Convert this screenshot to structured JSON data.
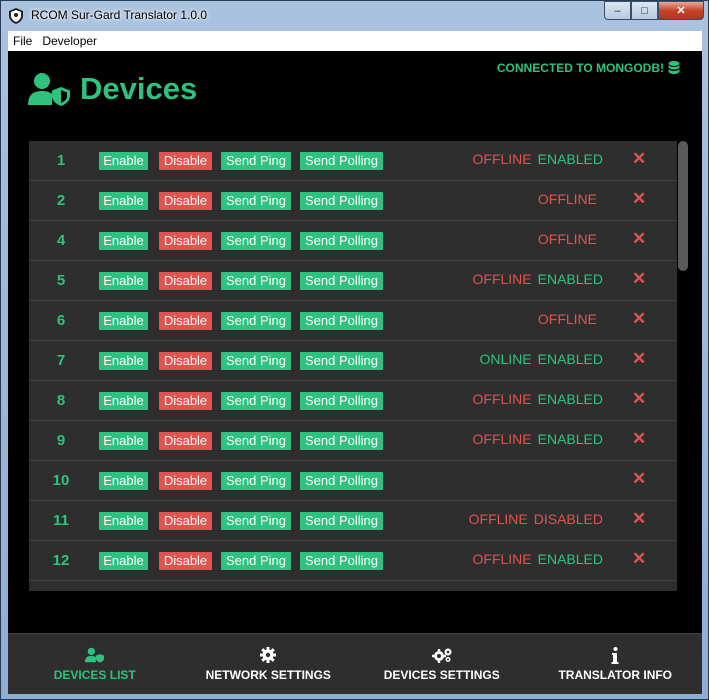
{
  "window": {
    "title": "RCOM Sur-Gard Translator 1.0.0",
    "min": "–",
    "max": "□",
    "close": "✕"
  },
  "menu": {
    "items": [
      "File",
      "Developer"
    ]
  },
  "header": {
    "title": "Devices",
    "connection": "CONNECTED TO MONGODB!"
  },
  "labels": {
    "enable": "Enable",
    "disable": "Disable",
    "ping": "Send Ping",
    "poll": "Send Polling",
    "delete": "✕"
  },
  "devices": [
    {
      "id": "1",
      "conn": "OFFLINE",
      "state": "ENABLED"
    },
    {
      "id": "2",
      "conn": "OFFLINE",
      "state": ""
    },
    {
      "id": "4",
      "conn": "OFFLINE",
      "state": ""
    },
    {
      "id": "5",
      "conn": "OFFLINE",
      "state": "ENABLED"
    },
    {
      "id": "6",
      "conn": "OFFLINE",
      "state": ""
    },
    {
      "id": "7",
      "conn": "ONLINE",
      "state": "ENABLED"
    },
    {
      "id": "8",
      "conn": "OFFLINE",
      "state": "ENABLED"
    },
    {
      "id": "9",
      "conn": "OFFLINE",
      "state": "ENABLED"
    },
    {
      "id": "10",
      "conn": "",
      "state": ""
    },
    {
      "id": "11",
      "conn": "OFFLINE",
      "state": "DISABLED"
    },
    {
      "id": "12",
      "conn": "OFFLINE",
      "state": "ENABLED"
    }
  ],
  "nav": [
    {
      "label": "DEVICES LIST",
      "icon": "user-shield-icon",
      "active": true
    },
    {
      "label": "NETWORK SETTINGS",
      "icon": "gear-icon",
      "active": false
    },
    {
      "label": "DEVICES SETTINGS",
      "icon": "gears-icon",
      "active": false
    },
    {
      "label": "TRANSLATOR INFO",
      "icon": "info-icon",
      "active": false
    }
  ],
  "colors": {
    "accent": "#2ec27e",
    "danger": "#e0534f",
    "panel": "#2e2e2e",
    "background": "#000000"
  }
}
